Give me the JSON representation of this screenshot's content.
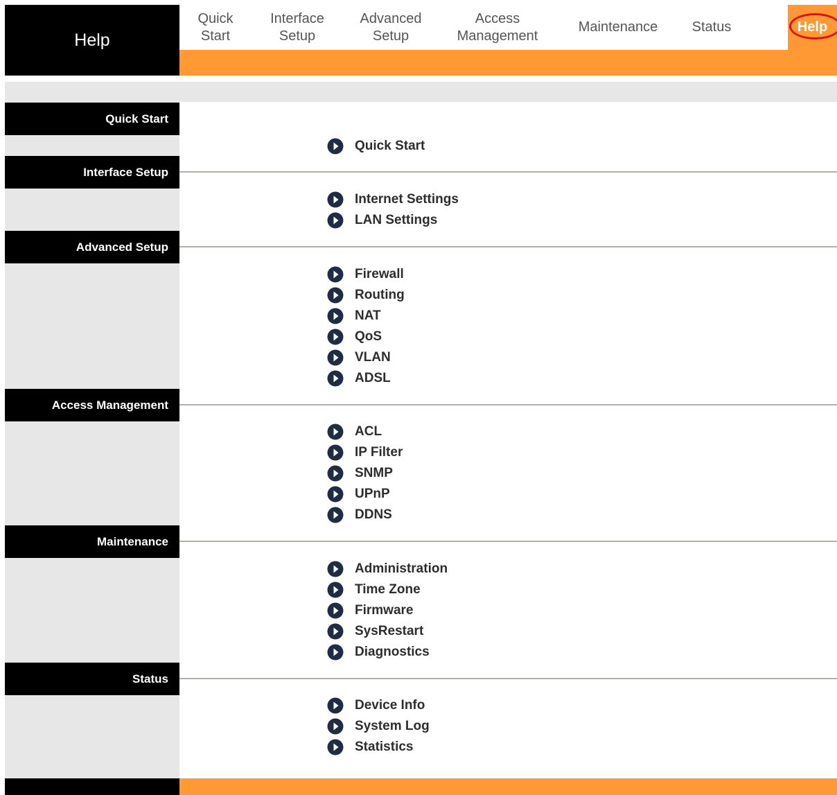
{
  "page_title": "Help",
  "nav": [
    {
      "line1": "Quick",
      "line2": "Start"
    },
    {
      "line1": "Interface",
      "line2": "Setup"
    },
    {
      "line1": "Advanced",
      "line2": "Setup"
    },
    {
      "line1": "Access",
      "line2": "Management"
    },
    {
      "line1": "Maintenance",
      "line2": ""
    },
    {
      "line1": "Status",
      "line2": ""
    },
    {
      "line1": "Help",
      "line2": ""
    }
  ],
  "active_tab": "Help",
  "colors": {
    "accent": "#ff9933",
    "header_bg": "#000000",
    "panel_bg": "#e7e7e7",
    "highlight_ring": "#e01010",
    "link_icon": "#1f2d44"
  },
  "icons": {
    "link_bullet": "arrow-circle-right-icon"
  },
  "sections": [
    {
      "title": "Quick Start",
      "links": [
        "Quick Start"
      ]
    },
    {
      "title": "Interface Setup",
      "links": [
        "Internet Settings",
        "LAN Settings"
      ]
    },
    {
      "title": "Advanced Setup",
      "links": [
        "Firewall",
        "Routing",
        "NAT",
        "QoS",
        "VLAN",
        "ADSL"
      ]
    },
    {
      "title": "Access Management",
      "links": [
        "ACL",
        "IP Filter",
        "SNMP",
        "UPnP",
        "DDNS"
      ]
    },
    {
      "title": "Maintenance",
      "links": [
        "Administration",
        "Time Zone",
        "Firmware",
        "SysRestart",
        "Diagnostics"
      ]
    },
    {
      "title": "Status",
      "links": [
        "Device Info",
        "System Log",
        "Statistics"
      ]
    }
  ]
}
